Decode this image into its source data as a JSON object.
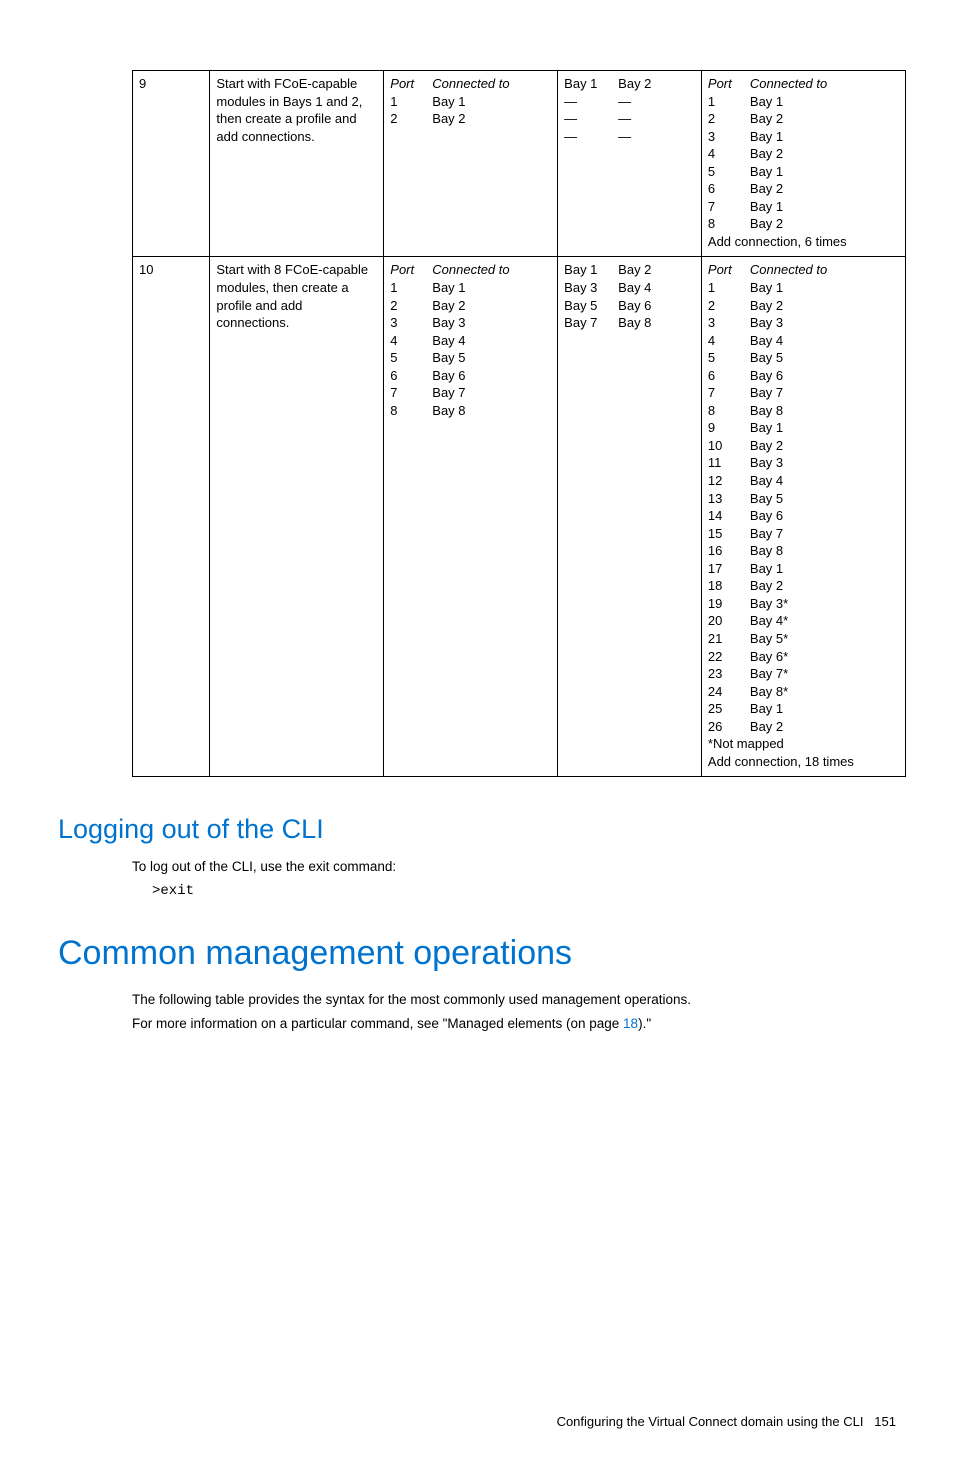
{
  "rows": [
    {
      "id": "9",
      "desc": "Start with FCoE-capable modules in Bays 1 and 2, then create a profile and add connections.",
      "portHeadL": "Port",
      "connHeadL": "Connected to",
      "portsL": [
        {
          "p": "1",
          "c": "Bay 1"
        },
        {
          "p": "2",
          "c": "Bay 2"
        }
      ],
      "baysHead": [
        "Bay 1",
        "Bay 2"
      ],
      "bays": [
        [
          "—",
          "—"
        ],
        [
          "—",
          "—"
        ],
        [
          "—",
          "—"
        ]
      ],
      "portHeadR": "Port",
      "connHeadR": "Connected to",
      "portsR": [
        {
          "p": "1",
          "c": "Bay 1"
        },
        {
          "p": "2",
          "c": "Bay 2"
        },
        {
          "p": "3",
          "c": "Bay 1"
        },
        {
          "p": "4",
          "c": "Bay 2"
        },
        {
          "p": "5",
          "c": "Bay 1"
        },
        {
          "p": "6",
          "c": "Bay 2"
        },
        {
          "p": "7",
          "c": "Bay 1"
        },
        {
          "p": "8",
          "c": "Bay 2"
        }
      ],
      "noteR": "Add connection, 6 times"
    },
    {
      "id": "10",
      "desc": "Start with 8 FCoE-capable modules, then create a profile and add connections.",
      "portHeadL": "Port",
      "connHeadL": "Connected to",
      "portsL": [
        {
          "p": "1",
          "c": "Bay 1"
        },
        {
          "p": "2",
          "c": "Bay 2"
        },
        {
          "p": "3",
          "c": "Bay 3"
        },
        {
          "p": "4",
          "c": "Bay 4"
        },
        {
          "p": "5",
          "c": "Bay 5"
        },
        {
          "p": "6",
          "c": "Bay 6"
        },
        {
          "p": "7",
          "c": "Bay 7"
        },
        {
          "p": "8",
          "c": "Bay 8"
        }
      ],
      "baysHead": [
        "Bay 1",
        "Bay 2"
      ],
      "bays": [
        [
          "Bay 3",
          "Bay 4"
        ],
        [
          "Bay 5",
          "Bay 6"
        ],
        [
          "Bay 7",
          "Bay 8"
        ]
      ],
      "portHeadR": "Port",
      "connHeadR": "Connected to",
      "portsR": [
        {
          "p": "1",
          "c": "Bay 1"
        },
        {
          "p": "2",
          "c": "Bay 2"
        },
        {
          "p": "3",
          "c": "Bay 3"
        },
        {
          "p": "4",
          "c": "Bay 4"
        },
        {
          "p": "5",
          "c": "Bay 5"
        },
        {
          "p": "6",
          "c": "Bay 6"
        },
        {
          "p": "7",
          "c": "Bay 7"
        },
        {
          "p": "8",
          "c": "Bay 8"
        },
        {
          "p": "9",
          "c": "Bay 1"
        },
        {
          "p": "10",
          "c": "Bay 2"
        },
        {
          "p": "11",
          "c": "Bay 3"
        },
        {
          "p": "12",
          "c": "Bay 4"
        },
        {
          "p": "13",
          "c": "Bay 5"
        },
        {
          "p": "14",
          "c": "Bay 6"
        },
        {
          "p": "15",
          "c": "Bay 7"
        },
        {
          "p": "16",
          "c": "Bay 8"
        },
        {
          "p": "17",
          "c": "Bay 1"
        },
        {
          "p": "18",
          "c": "Bay 2"
        },
        {
          "p": "19",
          "c": "Bay 3*"
        },
        {
          "p": "20",
          "c": "Bay 4*"
        },
        {
          "p": "21",
          "c": "Bay 5*"
        },
        {
          "p": "22",
          "c": "Bay 6*"
        },
        {
          "p": "23",
          "c": "Bay 7*"
        },
        {
          "p": "24",
          "c": "Bay 8*"
        },
        {
          "p": "25",
          "c": "Bay 1"
        },
        {
          "p": "26",
          "c": "Bay 2"
        }
      ],
      "noteR1": "*Not mapped",
      "noteR": "Add connection, 18 times"
    }
  ],
  "h2_logout": "Logging out of the CLI",
  "p_logout": "To log out of the CLI, use the exit command:",
  "code_exit": ">exit",
  "h1_common": "Common management operations",
  "p_common1": "The following table provides the syntax for the most commonly used management operations.",
  "p_common2_a": "For more information on a particular command, see \"Managed elements (on page ",
  "p_common2_link": "18",
  "p_common2_b": ").\"",
  "footer_text": "Configuring the Virtual Connect domain using the CLI",
  "footer_page": "151"
}
